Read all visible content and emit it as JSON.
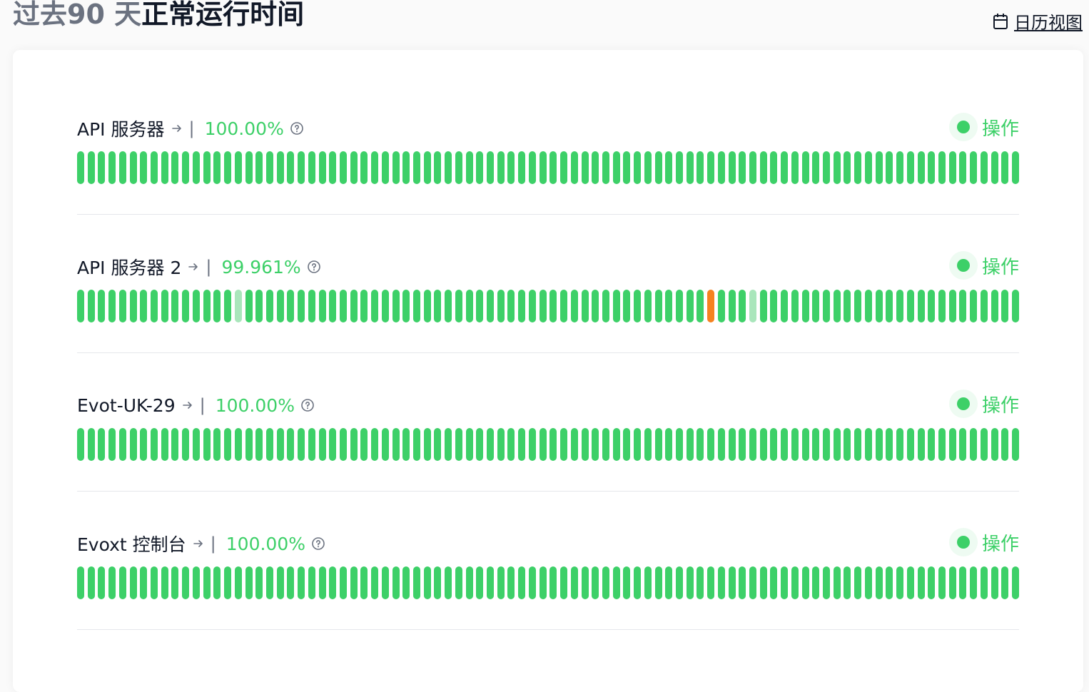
{
  "header": {
    "title_prefix": "过去90 天",
    "title_main": "正常运行时间",
    "calendar_link": "日历视图"
  },
  "colors": {
    "operational": "#3dd068",
    "degraded": "#f58220",
    "no_data": "#a9e6bb"
  },
  "monitors": [
    {
      "name": "API 服务器",
      "separator": "|",
      "uptime": "100.00%",
      "status": "操作",
      "days_shown": 90,
      "day_status": {}
    },
    {
      "name": "API 服务器 2",
      "separator": "|",
      "uptime": "99.961%",
      "status": "操作",
      "days_shown": 90,
      "day_status": {
        "15": "no_data",
        "60": "degraded",
        "64": "no_data"
      }
    },
    {
      "name": "Evot-UK-29",
      "separator": "|",
      "uptime": "100.00%",
      "status": "操作",
      "days_shown": 90,
      "day_status": {}
    },
    {
      "name": "Evoxt 控制台",
      "separator": "|",
      "uptime": "100.00%",
      "status": "操作",
      "days_shown": 90,
      "day_status": {}
    }
  ]
}
